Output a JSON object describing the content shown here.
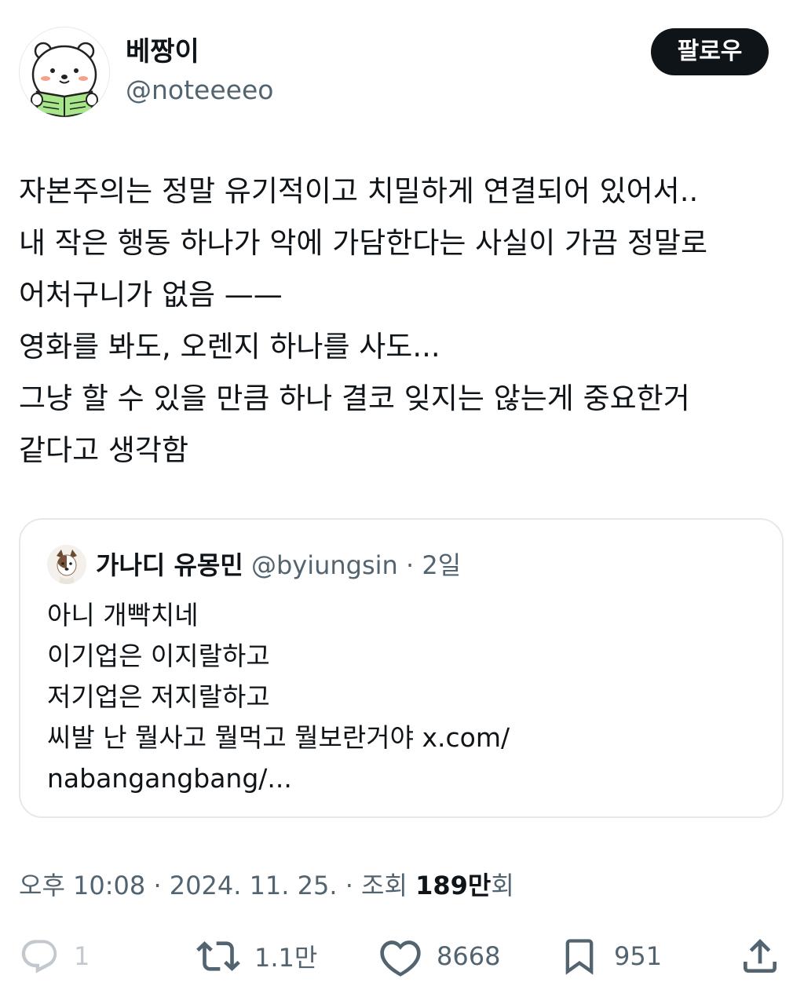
{
  "author": {
    "display_name": "베짱이",
    "handle": "@noteeeeo"
  },
  "follow_button_label": "팔로우",
  "tweet": {
    "lines": [
      "자본주의는 정말 유기적이고 치밀하게 연결되어 있어서..",
      "내 작은 행동 하나가 악에 가담한다는 사실이 가끔 정말로",
      "어처구니가 없음 ——",
      "영화를 봐도, 오렌지 하나를 사도...",
      "그냥 할 수 있을 만큼 하나 결코 잊지는 않는게 중요한거",
      "같다고 생각함"
    ]
  },
  "quoted_tweet": {
    "display_name": "가나디 유몽민",
    "handle": "@byiungsin",
    "separator": "·",
    "time": "2일",
    "lines": [
      "아니 개빡치네",
      "이기업은 이지랄하고",
      "저기업은 저지랄하고",
      "씨발 난 뭘사고 뭘먹고 뭘보란거야 x.com/",
      "nabangangbang/..."
    ]
  },
  "meta": {
    "timestamp": "오후 10:08 · 2024. 11. 25. · 조회 ",
    "views_count": "189만",
    "views_suffix": "회"
  },
  "actions": {
    "reply_count": "1",
    "retweet_count": "1.1만",
    "like_count": "8668",
    "bookmark_count": "951"
  },
  "icons": {
    "reply": "reply-icon",
    "retweet": "retweet-icon",
    "like": "heart-icon",
    "bookmark": "bookmark-icon",
    "share": "share-icon"
  },
  "colors": {
    "text": "#0f1419",
    "secondary": "#536471",
    "border": "#e6e9ec",
    "button_bg": "#0f1419",
    "avatar_book": "#a8e68a"
  }
}
